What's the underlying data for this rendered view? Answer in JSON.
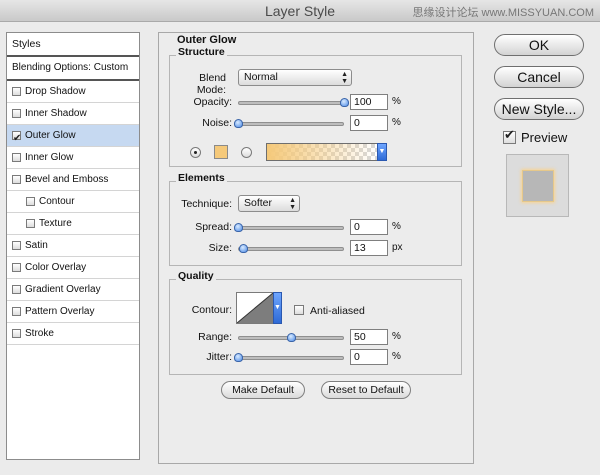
{
  "window": {
    "title": "Layer Style",
    "watermark": "思缘设计论坛 www.MISSYUAN.COM"
  },
  "styles_panel": {
    "header": "Styles",
    "blending_options": "Blending Options: Custom",
    "items": [
      {
        "label": "Drop Shadow",
        "checked": false
      },
      {
        "label": "Inner Shadow",
        "checked": false
      },
      {
        "label": "Outer Glow",
        "checked": true
      },
      {
        "label": "Inner Glow",
        "checked": false
      },
      {
        "label": "Bevel and Emboss",
        "checked": false
      },
      {
        "label": "Contour",
        "checked": false
      },
      {
        "label": "Texture",
        "checked": false
      },
      {
        "label": "Satin",
        "checked": false
      },
      {
        "label": "Color Overlay",
        "checked": false
      },
      {
        "label": "Gradient Overlay",
        "checked": false
      },
      {
        "label": "Pattern Overlay",
        "checked": false
      },
      {
        "label": "Stroke",
        "checked": false
      }
    ]
  },
  "outer_glow": {
    "title": "Outer Glow",
    "structure": {
      "title": "Structure",
      "blend_mode_label": "Blend Mode:",
      "blend_mode_value": "Normal",
      "opacity_label": "Opacity:",
      "opacity_value": "100",
      "opacity_unit": "%",
      "opacity_level": 1.0,
      "noise_label": "Noise:",
      "noise_value": "0",
      "noise_unit": "%",
      "noise_level": 0.0,
      "glow_color": "#f5c97a"
    },
    "elements": {
      "title": "Elements",
      "technique_label": "Technique:",
      "technique_value": "Softer",
      "spread_label": "Spread:",
      "spread_value": "0",
      "spread_unit": "%",
      "spread_level": 0.0,
      "size_label": "Size:",
      "size_value": "13",
      "size_unit": "px",
      "size_level": 0.05
    },
    "quality": {
      "title": "Quality",
      "contour_label": "Contour:",
      "anti_aliased_label": "Anti-aliased",
      "anti_aliased_checked": false,
      "range_label": "Range:",
      "range_value": "50",
      "range_unit": "%",
      "range_level": 0.5,
      "jitter_label": "Jitter:",
      "jitter_value": "0",
      "jitter_unit": "%",
      "jitter_level": 0.0
    },
    "make_default": "Make Default",
    "reset_default": "Reset to Default"
  },
  "actions": {
    "ok": "OK",
    "cancel": "Cancel",
    "new_style": "New Style...",
    "preview_label": "Preview",
    "preview_checked": true
  }
}
